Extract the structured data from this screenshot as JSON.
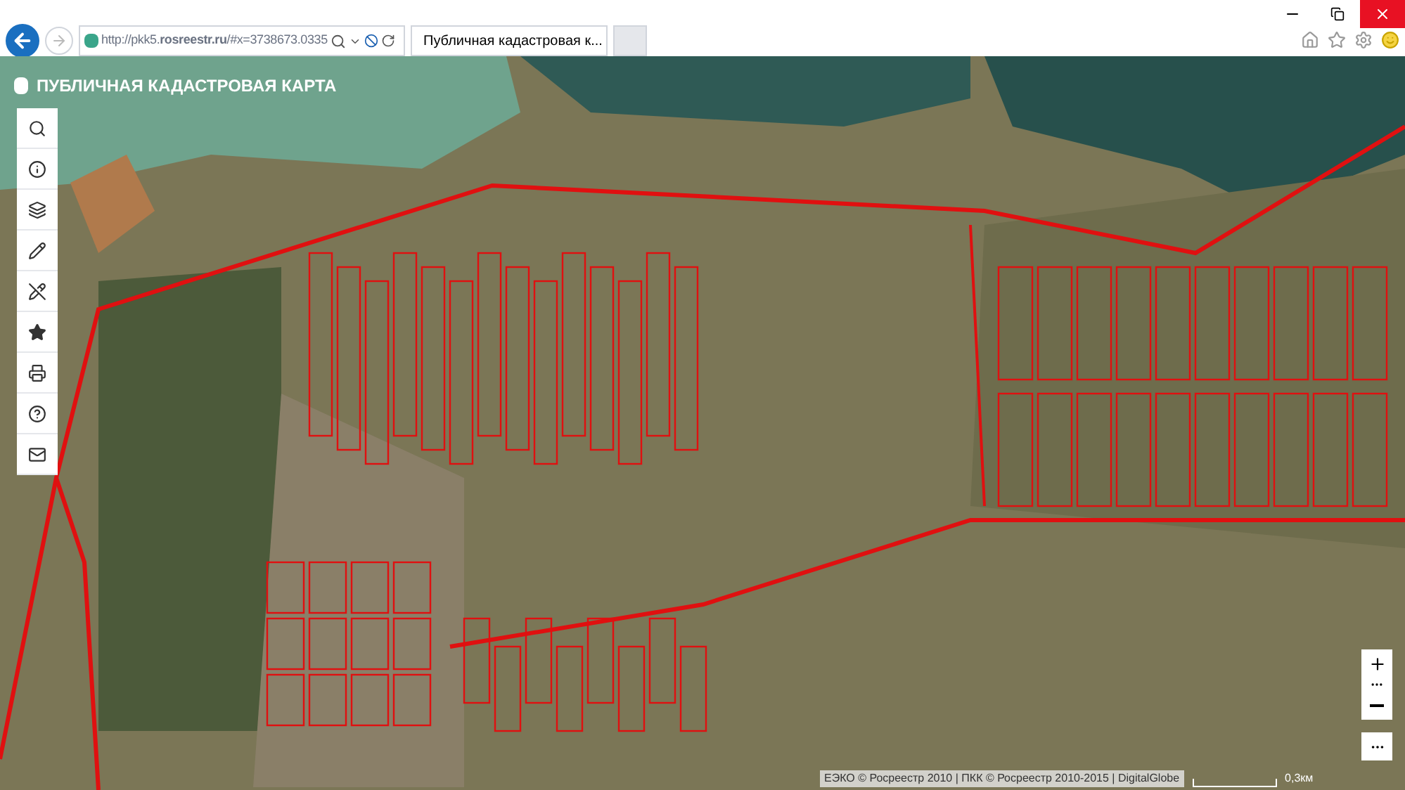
{
  "browser": {
    "address": "http://pkk5.**rosreestr.ru**/#x=3738673.0335",
    "tabs": [
      {
        "title": "Публичная кадастровая к...",
        "selected": true
      }
    ]
  },
  "app": {
    "title": "ПУБЛИЧНАЯ КАДАСТРОВАЯ КАРТА"
  },
  "map": {
    "attribution": "ЕЭКО © Росреестр 2010 | ПКК © Росреестр 2010-2015 | DigitalGlobe",
    "scale": "0,3км"
  }
}
